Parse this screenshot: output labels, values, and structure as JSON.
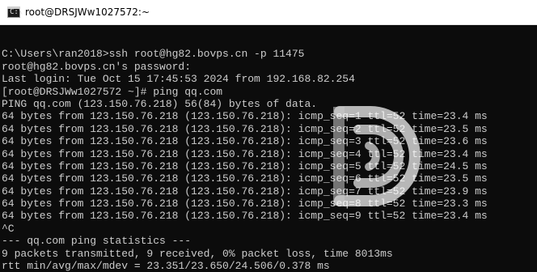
{
  "window": {
    "title": "root@DRSJWw1027572:~",
    "icon": "terminal-icon",
    "icon_glyph": "C:\\"
  },
  "terminal": {
    "lines": [
      "",
      "C:\\Users\\ran2018>ssh root@hg82.bovps.cn -p 11475",
      "root@hg82.bovps.cn's password:",
      "Last login: Tue Oct 15 17:45:53 2024 from 192.168.82.254",
      "[root@DRSJWw1027572 ~]# ping qq.com",
      "PING qq.com (123.150.76.218) 56(84) bytes of data.",
      "64 bytes from 123.150.76.218 (123.150.76.218): icmp_seq=1 ttl=52 time=23.4 ms",
      "64 bytes from 123.150.76.218 (123.150.76.218): icmp_seq=2 ttl=52 time=23.5 ms",
      "64 bytes from 123.150.76.218 (123.150.76.218): icmp_seq=3 ttl=52 time=23.6 ms",
      "64 bytes from 123.150.76.218 (123.150.76.218): icmp_seq=4 ttl=52 time=23.4 ms",
      "64 bytes from 123.150.76.218 (123.150.76.218): icmp_seq=5 ttl=52 time=24.5 ms",
      "64 bytes from 123.150.76.218 (123.150.76.218): icmp_seq=6 ttl=52 time=23.5 ms",
      "64 bytes from 123.150.76.218 (123.150.76.218): icmp_seq=7 ttl=52 time=23.9 ms",
      "64 bytes from 123.150.76.218 (123.150.76.218): icmp_seq=8 ttl=52 time=23.3 ms",
      "64 bytes from 123.150.76.218 (123.150.76.218): icmp_seq=9 ttl=52 time=23.4 ms",
      "^C",
      "--- qq.com ping statistics ---",
      "9 packets transmitted, 9 received, 0% packet loss, time 8013ms",
      "rtt min/avg/max/mdev = 23.351/23.650/24.506/0.378 ms"
    ],
    "text_color": "#cccccc",
    "background": "#0c0c0c"
  },
  "watermark": {
    "icon": "logo-watermark-icon",
    "color": "#ffffff"
  }
}
